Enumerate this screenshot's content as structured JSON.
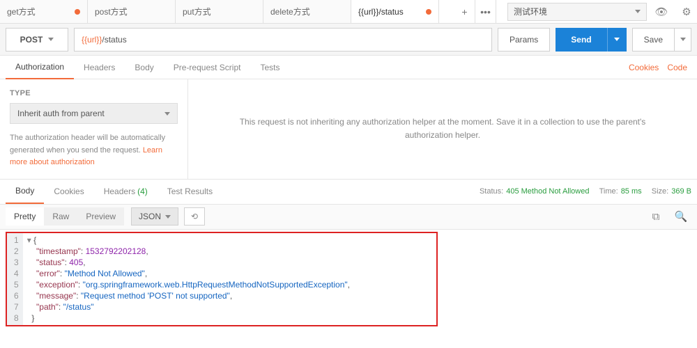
{
  "tabs": [
    {
      "label": "get方式",
      "dirty": true
    },
    {
      "label": "post方式",
      "dirty": false
    },
    {
      "label": "put方式",
      "dirty": false
    },
    {
      "label": "delete方式",
      "dirty": false
    },
    {
      "label": "{{url}}/status",
      "dirty": true,
      "active": true
    }
  ],
  "env": {
    "selected": "测试环境"
  },
  "request": {
    "method": "POST",
    "url_prefix": "{{url}}",
    "url_rest": "/status",
    "params_btn": "Params",
    "send_btn": "Send",
    "save_btn": "Save"
  },
  "req_subtabs": {
    "items": [
      "Authorization",
      "Headers",
      "Body",
      "Pre-request Script",
      "Tests"
    ],
    "active": "Authorization",
    "links": {
      "cookies": "Cookies",
      "code": "Code"
    }
  },
  "auth": {
    "type_label": "TYPE",
    "type_value": "Inherit auth from parent",
    "help_text": "The authorization header will be automatically generated when you send the request. ",
    "learn_link": "Learn more about authorization",
    "right_text": "This request is not inheriting any authorization helper at the moment. Save it in a collection to use the parent's authorization helper."
  },
  "resp_tabs": {
    "items": [
      {
        "label": "Body",
        "active": true
      },
      {
        "label": "Cookies"
      },
      {
        "label": "Headers",
        "badge": "(4)"
      },
      {
        "label": "Test Results"
      }
    ],
    "status_label": "Status:",
    "status_value": "405 Method Not Allowed",
    "time_label": "Time:",
    "time_value": "85 ms",
    "size_label": "Size:",
    "size_value": "369 B"
  },
  "viewer": {
    "modes": [
      "Pretty",
      "Raw",
      "Preview"
    ],
    "active_mode": "Pretty",
    "format": "JSON"
  },
  "response_body": {
    "timestamp": 1532792202128,
    "status": 405,
    "error": "Method Not Allowed",
    "exception": "org.springframework.web.HttpRequestMethodNotSupportedException",
    "message": "Request method 'POST' not supported",
    "path": "/status"
  }
}
